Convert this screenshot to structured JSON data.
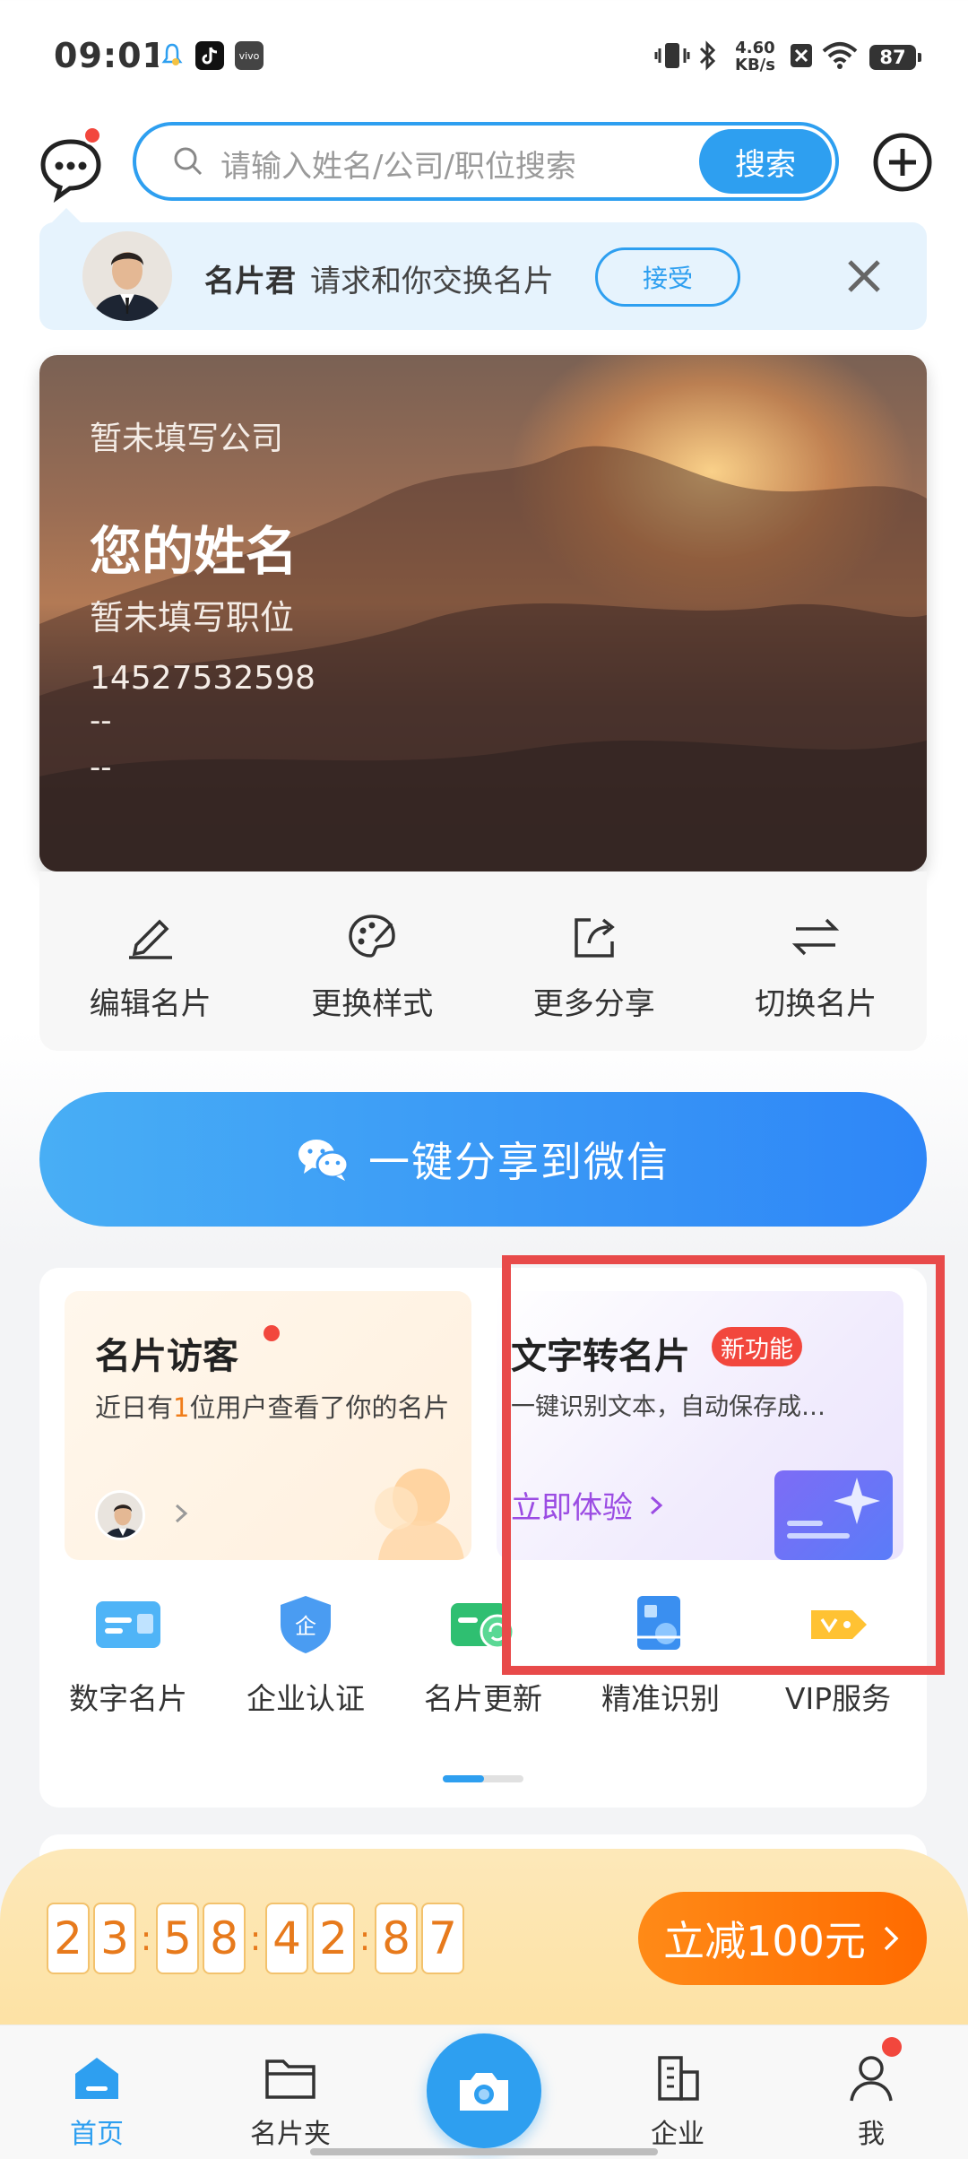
{
  "status_bar": {
    "time": "09:01",
    "net_speed_value": "4.60",
    "net_speed_unit": "KB/s",
    "battery": "87"
  },
  "header": {
    "search_placeholder": "请输入姓名/公司/职位搜索",
    "search_button": "搜索"
  },
  "request": {
    "name": "名片君",
    "text": "请求和你交换名片",
    "accept_label": "接受"
  },
  "card": {
    "company": "暂未填写公司",
    "name": "您的姓名",
    "position": "暂未填写职位",
    "phone": "14527532598",
    "line1": "--",
    "line2": "--"
  },
  "card_actions": [
    {
      "label": "编辑名片",
      "icon": "pencil-icon"
    },
    {
      "label": "更换样式",
      "icon": "palette-icon"
    },
    {
      "label": "更多分享",
      "icon": "share-icon"
    },
    {
      "label": "切换名片",
      "icon": "swap-icon"
    }
  ],
  "share": {
    "label": "一键分享到微信",
    "icon": "wechat-icon"
  },
  "features": {
    "visitors": {
      "title": "名片访客",
      "desc_prefix": "近日有",
      "desc_count": "1",
      "desc_suffix": "位用户查看了你的名片"
    },
    "text_to_card": {
      "title": "文字转名片",
      "badge": "新功能",
      "desc": "一键识别文本，自动保存成…",
      "cta": "立即体验"
    }
  },
  "shortcuts": [
    {
      "label": "数字名片",
      "icon": "digital-card-icon"
    },
    {
      "label": "企业认证",
      "icon": "enterprise-verify-icon"
    },
    {
      "label": "名片更新",
      "icon": "card-update-icon"
    },
    {
      "label": "精准识别",
      "icon": "precise-recognition-icon"
    },
    {
      "label": "VIP服务",
      "icon": "vip-icon"
    }
  ],
  "promo": {
    "countdown": [
      "2",
      "3",
      "5",
      "8",
      "4",
      "2",
      "8",
      "7"
    ],
    "button_label": "立减100元"
  },
  "bottom_nav": [
    {
      "label": "首页",
      "icon": "home-icon",
      "active": true
    },
    {
      "label": "名片夹",
      "icon": "folder-icon",
      "active": false
    },
    {
      "label": "",
      "icon": "camera-icon",
      "active": false
    },
    {
      "label": "企业",
      "icon": "building-icon",
      "active": false
    },
    {
      "label": "我",
      "icon": "user-icon",
      "active": false
    }
  ],
  "colors": {
    "primary": "#2e9ff0",
    "badge_red": "#f2473d",
    "orange": "#ff7a0f",
    "highlight": "#e84a4a",
    "purple_link": "#9b4ce3"
  }
}
